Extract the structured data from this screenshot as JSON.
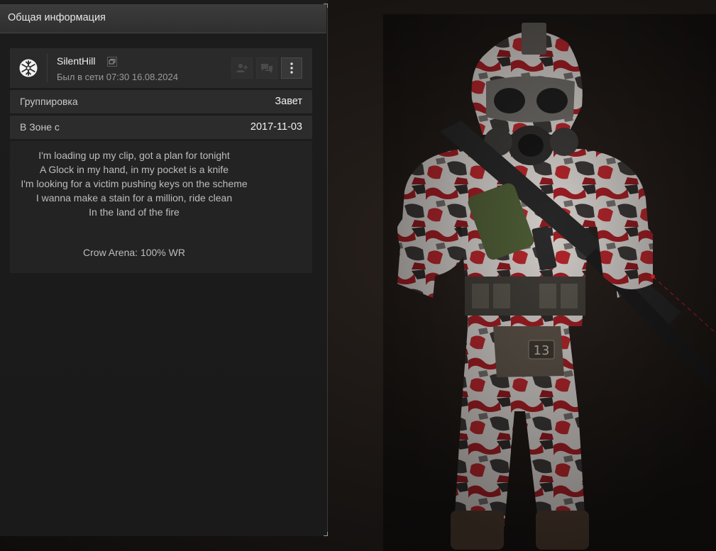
{
  "panel": {
    "title": "Общая информация"
  },
  "profile": {
    "nickname": "SilentHill",
    "last_seen": "Был в сети 07:30 16.08.2024",
    "logo_icon": "snowflake-emblem-icon",
    "copy_icon": "copy-icon",
    "buttons": [
      {
        "icon": "add-friend-icon"
      },
      {
        "icon": "chat-icon"
      },
      {
        "icon": "more-vertical-icon"
      }
    ]
  },
  "info": {
    "faction_label": "Группировка",
    "faction_value": "Завет",
    "zone_label": "В Зоне с",
    "zone_value": "2017-11-03"
  },
  "bio": {
    "lines": [
      "I'm loading up my clip, got a plan for tonight",
      "A Glock in my hand, in my pocket is a knife",
      "I'm looking for a victim pushing keys on the scheme",
      "I wanna make a stain for a million, ride clean",
      "In the land of the fire"
    ],
    "extra": "Crow Arena: 100% WR"
  },
  "character": {
    "helmet_badge": "13"
  },
  "colors": {
    "accent_red": "#b0242a",
    "camo_white": "#d8d4d0",
    "laser": "#ff2020"
  }
}
